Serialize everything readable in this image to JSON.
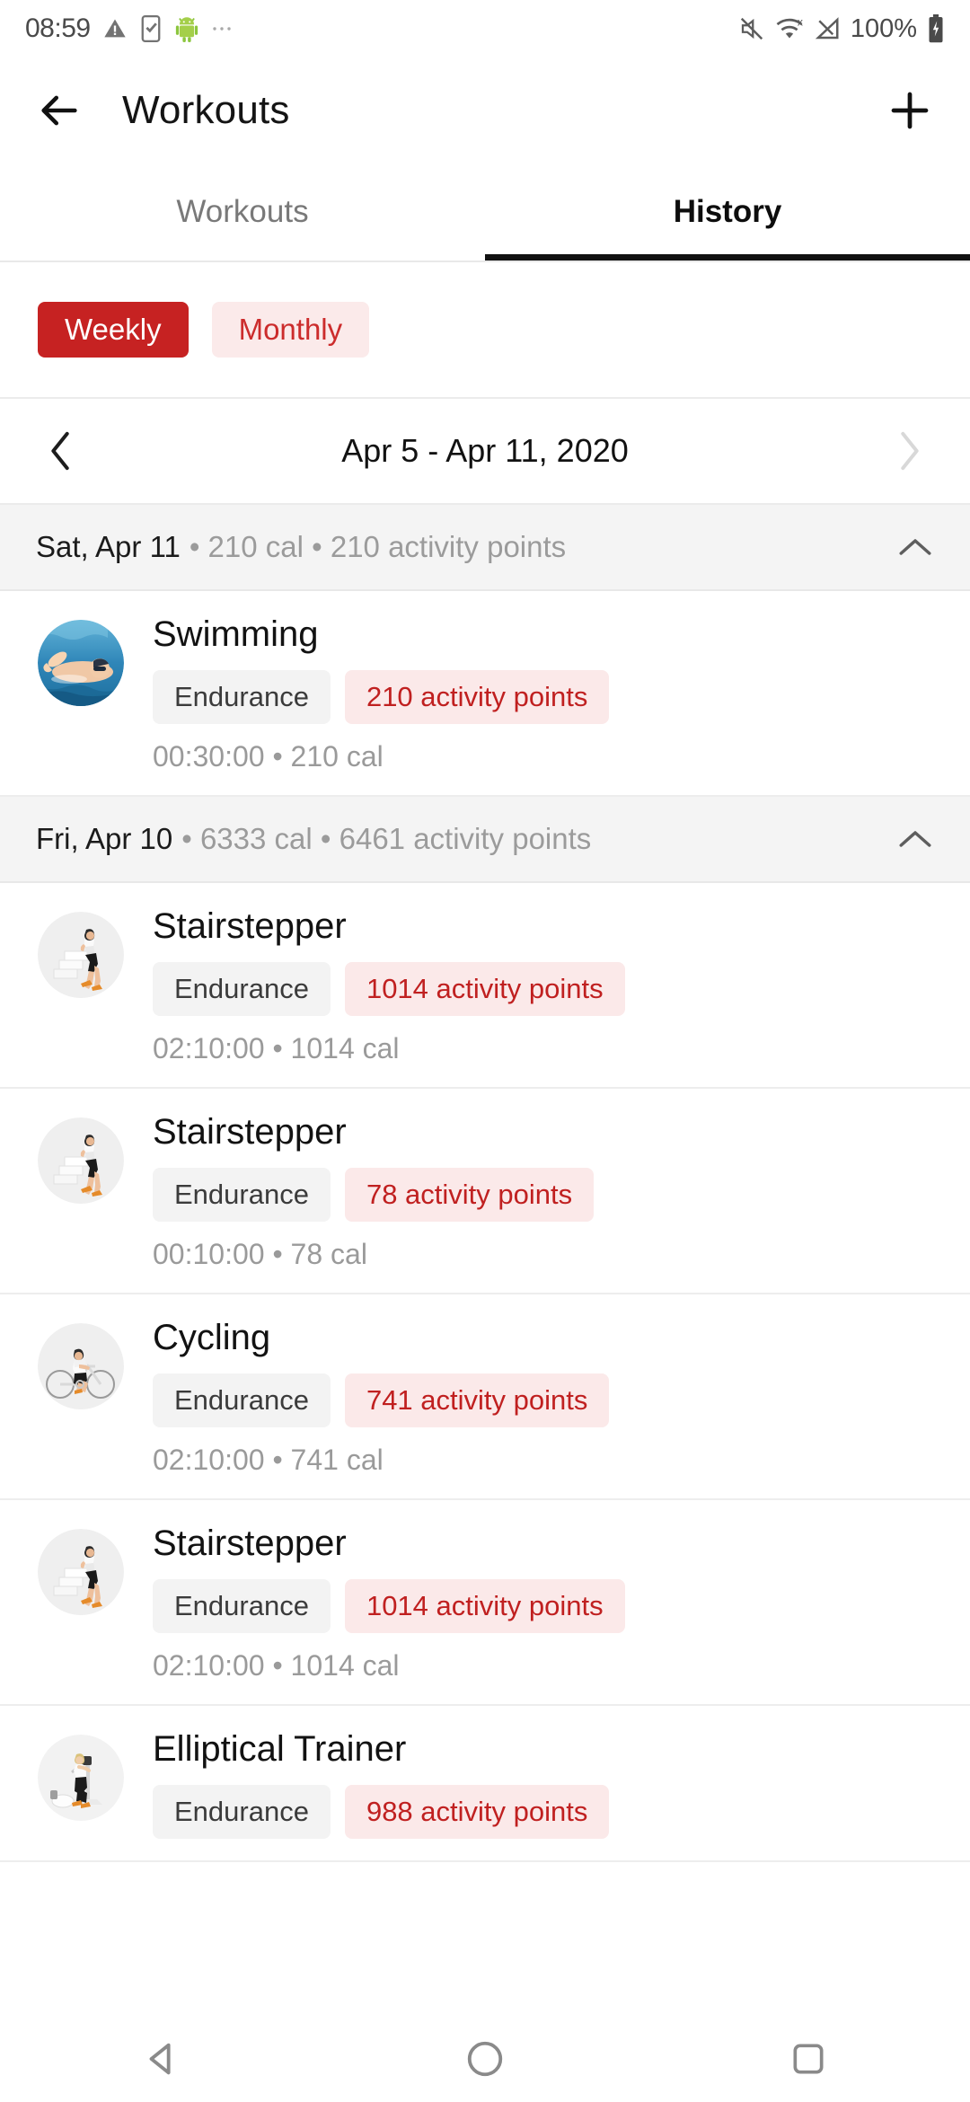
{
  "status_bar": {
    "time": "08:59",
    "battery_percent": "100%",
    "icons": [
      "warning-triangle-icon",
      "phone-check-icon",
      "android-robot-icon",
      "overflow-dots-icon",
      "mute-icon",
      "wifi-icon",
      "signal-no-service-icon",
      "battery-charging-icon"
    ]
  },
  "app_bar": {
    "title": "Workouts",
    "back_icon": "back-arrow-icon",
    "add_icon": "plus-icon"
  },
  "tabs": [
    {
      "label": "Workouts",
      "active": false
    },
    {
      "label": "History",
      "active": true
    }
  ],
  "period_filter": {
    "options": [
      {
        "label": "Weekly",
        "selected": true
      },
      {
        "label": "Monthly",
        "selected": false
      }
    ]
  },
  "date_nav": {
    "range": "Apr 5 - Apr 11, 2020",
    "prev_icon": "chevron-left-icon",
    "next_icon": "chevron-right-icon",
    "next_enabled": false
  },
  "colors": {
    "accent_red": "#c62222",
    "chip_red_bg": "#fbe9e9",
    "chip_red_text": "#c02020",
    "chip_gray_bg": "#f3f3f3",
    "group_header_bg": "#f4f4f4",
    "muted_text": "#9a9a9a"
  },
  "day_groups": [
    {
      "date": "Sat, Apr 11",
      "meta": "• 210 cal • 210 activity points",
      "collapse_icon": "chevron-up-icon",
      "workouts": [
        {
          "title": "Swimming",
          "category": "Endurance",
          "points": "210 activity points",
          "detail": "00:30:00 • 210 cal",
          "avatar": "swimming-photo"
        }
      ]
    },
    {
      "date": "Fri, Apr 10",
      "meta": "• 6333 cal • 6461 activity points",
      "collapse_icon": "chevron-up-icon",
      "workouts": [
        {
          "title": "Stairstepper",
          "category": "Endurance",
          "points": "1014 activity points",
          "detail": "02:10:00 • 1014 cal",
          "avatar": "stairstepper-photo"
        },
        {
          "title": "Stairstepper",
          "category": "Endurance",
          "points": "78 activity points",
          "detail": "00:10:00 • 78 cal",
          "avatar": "stairstepper-photo"
        },
        {
          "title": "Cycling",
          "category": "Endurance",
          "points": "741 activity points",
          "detail": "02:10:00 • 741 cal",
          "avatar": "cycling-photo"
        },
        {
          "title": "Stairstepper",
          "category": "Endurance",
          "points": "1014 activity points",
          "detail": "02:10:00 • 1014 cal",
          "avatar": "stairstepper-photo"
        },
        {
          "title": "Elliptical Trainer",
          "category": "Endurance",
          "points": "988 activity points",
          "detail": "",
          "avatar": "elliptical-photo"
        }
      ]
    }
  ],
  "nav_bar": {
    "back_icon": "nav-back-triangle-icon",
    "home_icon": "nav-home-circle-icon",
    "recents_icon": "nav-recents-square-icon"
  }
}
